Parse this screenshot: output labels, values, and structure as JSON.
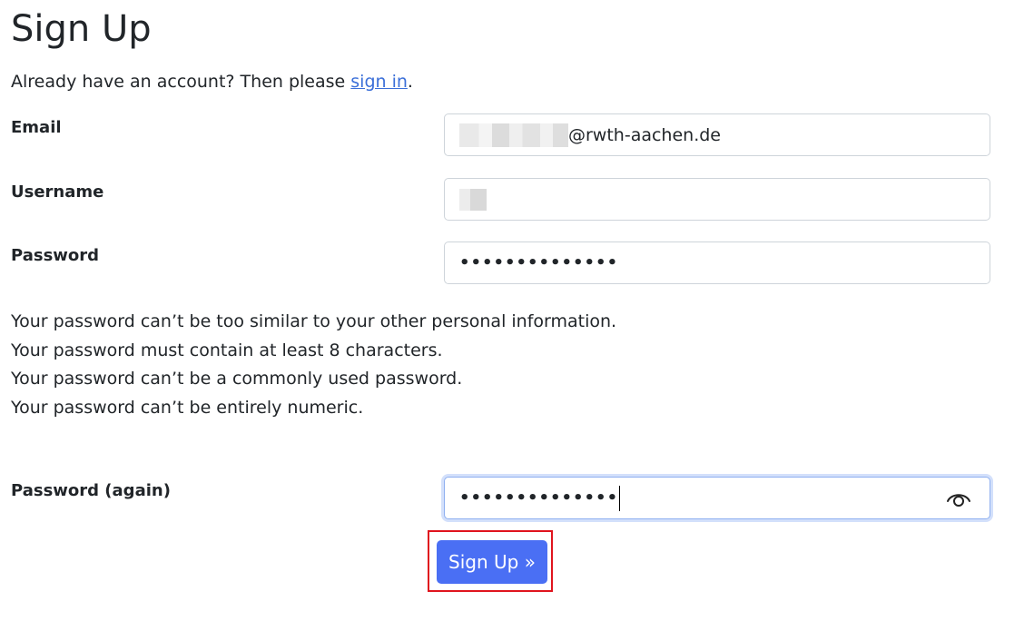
{
  "page": {
    "title": "Sign Up",
    "intro_prefix": "Already have an account? Then please ",
    "intro_link": "sign in",
    "intro_suffix": "."
  },
  "form": {
    "email": {
      "label": "Email",
      "value_suffix": "@rwth-aachen.de"
    },
    "username": {
      "label": "Username"
    },
    "password": {
      "label": "Password",
      "masked_value": "••••••••••••••"
    },
    "password_help": [
      "Your password can’t be too similar to your other personal information.",
      "Your password must contain at least 8 characters.",
      "Your password can’t be a commonly used password.",
      "Your password can’t be entirely numeric."
    ],
    "password_again": {
      "label": "Password (again)",
      "masked_value": "••••••••••••••",
      "reveal_icon": "eye-icon"
    },
    "submit_label": "Sign Up »"
  },
  "colors": {
    "primary_button": "#4a6ff4",
    "link": "#3b6fd8",
    "highlight_box": "#e0141e"
  }
}
